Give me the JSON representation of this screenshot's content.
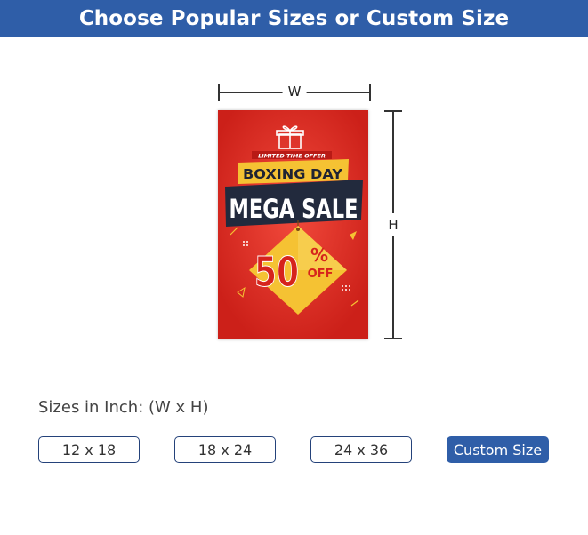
{
  "header": {
    "title": "Choose Popular Sizes or Custom Size"
  },
  "dimensions": {
    "width_label": "W",
    "height_label": "H"
  },
  "poster": {
    "ribbon_text": "LIMITED TIME OFFER",
    "headline_1": "BOXING DAY",
    "headline_2": "MEGA SALE",
    "discount_number": "50",
    "discount_percent": "%",
    "discount_off": "OFF",
    "colors": {
      "background": "#e02a23",
      "accent": "#f5c233",
      "dark": "#222a3d"
    }
  },
  "sizes": {
    "label": "Sizes in Inch: (W x H)",
    "options": [
      "12 x 18",
      "18 x 24",
      "24 x 36"
    ],
    "custom_label": "Custom Size"
  },
  "colors": {
    "primary": "#2f5ea8",
    "border": "#24427a"
  }
}
